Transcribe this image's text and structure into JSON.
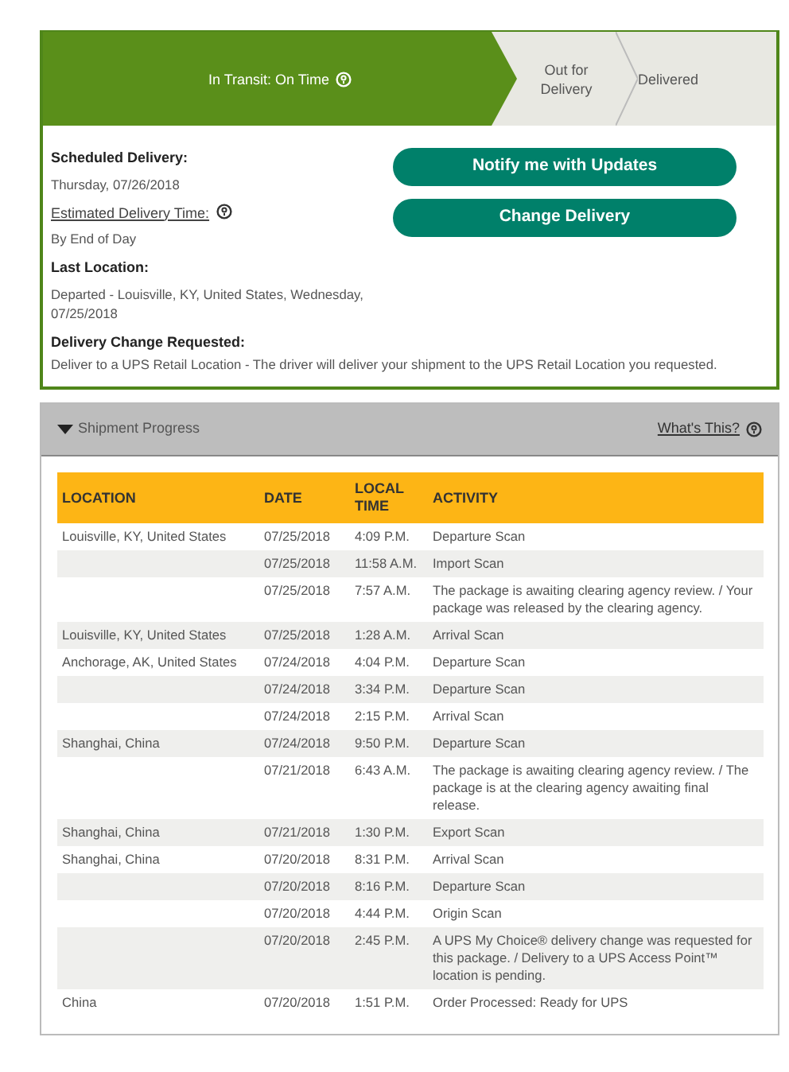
{
  "progress": {
    "steps": [
      {
        "label": "In Transit: On Time",
        "selected": true,
        "help": true
      },
      {
        "label": "Out for Delivery",
        "selected": false,
        "help": false
      },
      {
        "label": "Delivered",
        "selected": false,
        "help": false
      }
    ]
  },
  "details": [
    {
      "label": "Scheduled Delivery:",
      "kind": "plain",
      "value": "Thursday, 07/26/2018"
    },
    {
      "label": "Estimated Delivery Time:",
      "kind": "help-link",
      "value": "By End of Day"
    },
    {
      "label": "Last Location:",
      "kind": "plain",
      "value": "Departed - Louisville, KY, United States, Wednesday, 07/25/2018"
    },
    {
      "label": "Delivery Change Requested:",
      "kind": "wide",
      "value": "Deliver to a UPS Retail Location - The driver will deliver your shipment to the UPS Retail Location you requested."
    }
  ],
  "buttons": [
    "Notify me with Updates",
    "Change Delivery"
  ],
  "shipment_progress": {
    "title": "Shipment Progress",
    "expanded": true,
    "help_link": "What's This?",
    "table": {
      "columns": [
        "LOCATION",
        "DATE",
        "LOCAL TIME",
        "ACTIVITY"
      ],
      "rows": [
        [
          "Louisville, KY, United States",
          "07/25/2018",
          "4:09 P.M.",
          "Departure Scan"
        ],
        [
          "",
          "07/25/2018",
          "11:58 A.M.",
          "Import Scan"
        ],
        [
          "",
          "07/25/2018",
          "7:57 A.M.",
          "The package is awaiting clearing agency review. / Your package was released by the clearing agency."
        ],
        [
          "Louisville, KY, United States",
          "07/25/2018",
          "1:28 A.M.",
          "Arrival Scan"
        ],
        [
          "Anchorage, AK, United States",
          "07/24/2018",
          "4:04 P.M.",
          "Departure Scan"
        ],
        [
          "",
          "07/24/2018",
          "3:34 P.M.",
          "Departure Scan"
        ],
        [
          "",
          "07/24/2018",
          "2:15 P.M.",
          "Arrival Scan"
        ],
        [
          "Shanghai, China",
          "07/24/2018",
          "9:50 P.M.",
          "Departure Scan"
        ],
        [
          "",
          "07/21/2018",
          "6:43 A.M.",
          "The package is awaiting clearing agency review. / The package is at the clearing agency awaiting final release."
        ],
        [
          "Shanghai, China",
          "07/21/2018",
          "1:30 P.M.",
          "Export Scan"
        ],
        [
          "Shanghai, China",
          "07/20/2018",
          "8:31 P.M.",
          "Arrival Scan"
        ],
        [
          "",
          "07/20/2018",
          "8:16 P.M.",
          "Departure Scan"
        ],
        [
          "",
          "07/20/2018",
          "4:44 P.M.",
          "Origin Scan"
        ],
        [
          "",
          "07/20/2018",
          "2:45 P.M.",
          "A UPS My Choice® delivery change was requested for this package. / Delivery to a UPS Access Point™ location is pending."
        ],
        [
          "China",
          "07/20/2018",
          "1:51 P.M.",
          "Order Processed: Ready for UPS"
        ]
      ]
    }
  }
}
